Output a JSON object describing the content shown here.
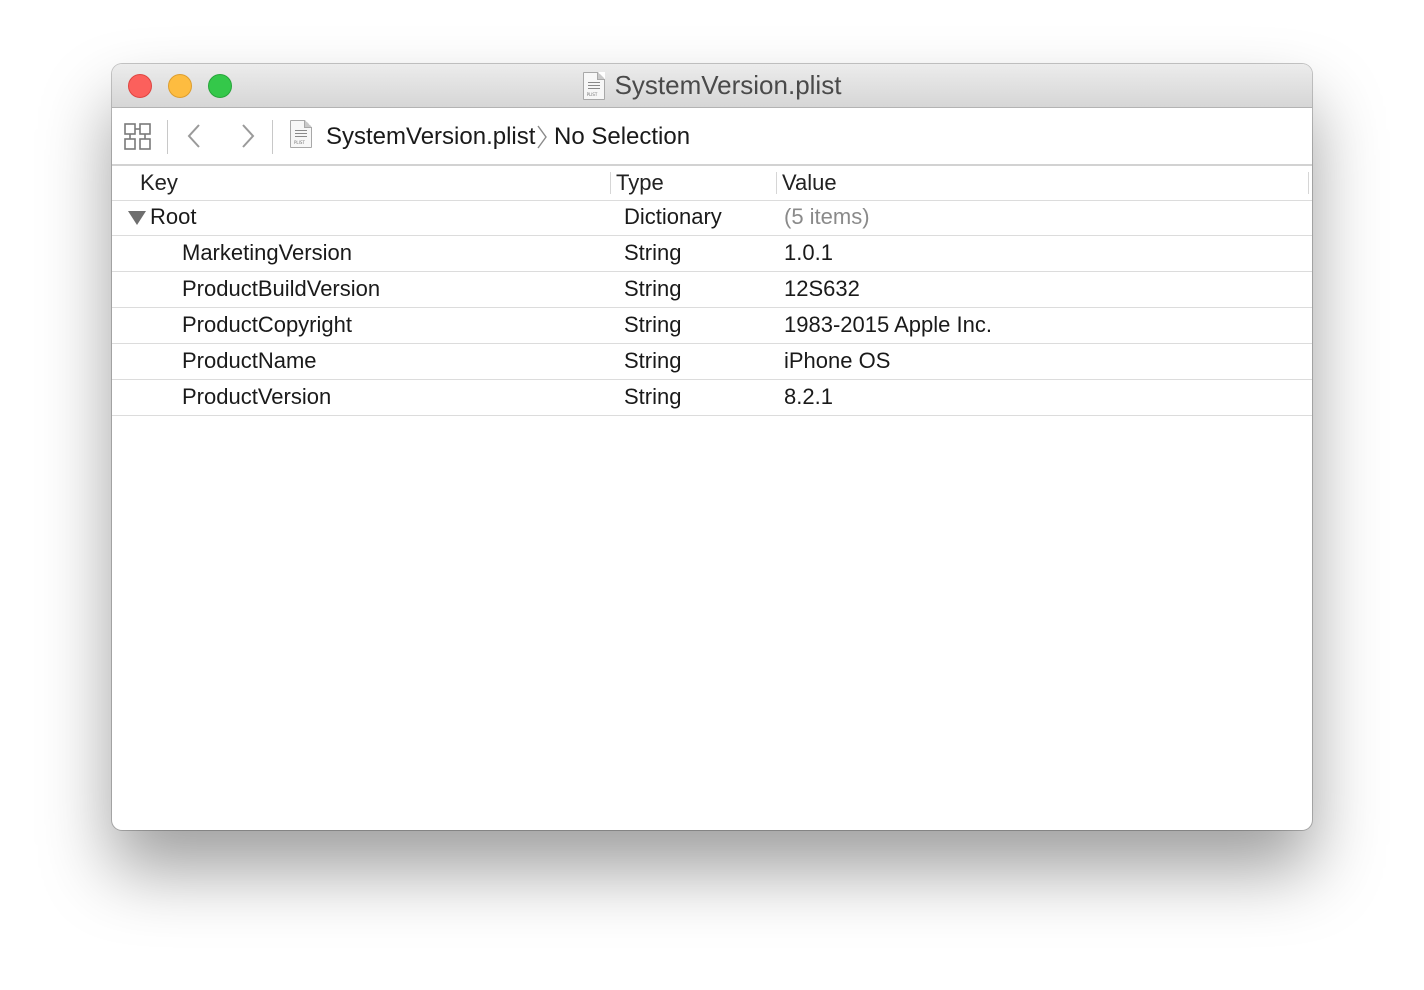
{
  "window": {
    "title": "SystemVersion.plist",
    "file_icon_tag": "PLIST"
  },
  "toolbar": {
    "breadcrumb_file": "SystemVersion.plist",
    "breadcrumb_selection": "No Selection"
  },
  "columns": {
    "key": "Key",
    "type": "Type",
    "value": "Value"
  },
  "root": {
    "key": "Root",
    "type": "Dictionary",
    "value": "(5 items)"
  },
  "rows": [
    {
      "key": "MarketingVersion",
      "type": "String",
      "value": "1.0.1"
    },
    {
      "key": "ProductBuildVersion",
      "type": "String",
      "value": "12S632"
    },
    {
      "key": "ProductCopyright",
      "type": "String",
      "value": "1983-2015 Apple Inc."
    },
    {
      "key": "ProductName",
      "type": "String",
      "value": "iPhone OS"
    },
    {
      "key": "ProductVersion",
      "type": "String",
      "value": "8.2.1"
    }
  ],
  "colors": {
    "close": "#fc605c",
    "minimize": "#fdbc40",
    "zoom": "#34c84a",
    "muted_value": "#8a8a8a"
  }
}
